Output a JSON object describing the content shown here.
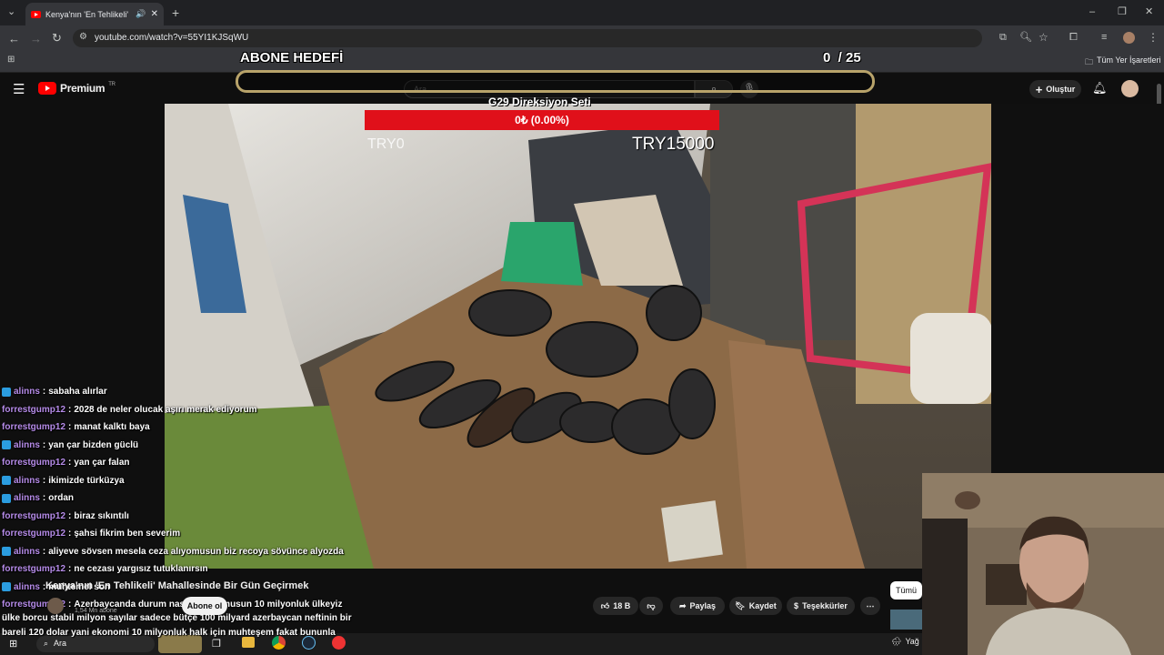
{
  "browser": {
    "tab_title": "Kenya'nın 'En Tehlikeli' Mah",
    "url": "youtube.com/watch?v=55YI1KJSqWU",
    "bookmarks_label": "Tüm Yer İşaretleri"
  },
  "youtube": {
    "logo_text": "Premium",
    "logo_region": "TR",
    "search_placeholder": "Ara",
    "create_label": "Oluştur"
  },
  "overlay": {
    "goal_title": "ABONE HEDEFİ",
    "goal_count": "0  / 25",
    "donation_title": "G29 Direksiyon Seti",
    "donation_progress_text": "0₺ (0.00%)",
    "donation_progress": 0,
    "try_start": "TRY0",
    "try_goal": "TRY15000"
  },
  "chat": [
    {
      "user": "alinns",
      "badge": true,
      "message": "sabaha alırlar"
    },
    {
      "user": "forrestgump12",
      "badge": false,
      "message": "2028 de neler olucak aşırı merak ediyorum"
    },
    {
      "user": "forrestgump12",
      "badge": false,
      "message": "manat kalktı baya"
    },
    {
      "user": "alinns",
      "badge": true,
      "message": "yan çar bizden güclü"
    },
    {
      "user": "forrestgump12",
      "badge": false,
      "message": "yan çar falan"
    },
    {
      "user": "alinns",
      "badge": true,
      "message": "ikimizde türküzya"
    },
    {
      "user": "alinns",
      "badge": true,
      "message": "ordan"
    },
    {
      "user": "forrestgump12",
      "badge": false,
      "message": "biraz sıkıntılı"
    },
    {
      "user": "forrestgump12",
      "badge": false,
      "message": "şahsi fikrim ben severim"
    },
    {
      "user": "alinns",
      "badge": true,
      "message": "aliyeve sövsen mesela ceza alıyomusun biz recoya sövünce alyozda"
    },
    {
      "user": "forrestgump12",
      "badge": false,
      "message": "ne cezası yargısız tutuklanırsın"
    },
    {
      "user": "alinns",
      "badge": true,
      "message": "muhtemel son"
    },
    {
      "user": "forrestgump12",
      "badge": false,
      "message": "Azerbaycanda durum nasıl biliyor musun 10 milyonluk ülkeyiz"
    }
  ],
  "chat_tail": "ülke borcu stabil milyon sayılar sadece bütçe 100 milyard azerbaycan neftinin bir bareli 120 dolar yani ekonomi 10 milyonluk halk için muhteşem fakat bununla",
  "video": {
    "title": "Kenya'nın 'En Tehlikeli' Mahallesinde Bir Gün Geçirmek",
    "channel_subs": "1,54 Mn abone",
    "subscribe_label": "Abone ol",
    "likes": "18 B",
    "share_label": "Paylaş",
    "save_label": "Kaydet",
    "thanks_label": "Teşekkürler",
    "all_label": "Tümü"
  },
  "taskbar": {
    "search_text": "Ara",
    "weather_text": "Yağ"
  },
  "colors": {
    "chat_user": "#b58be8",
    "donation_bar": "#e0101a",
    "goal_border": "#b8a36a",
    "yt_red": "#ff0000"
  }
}
